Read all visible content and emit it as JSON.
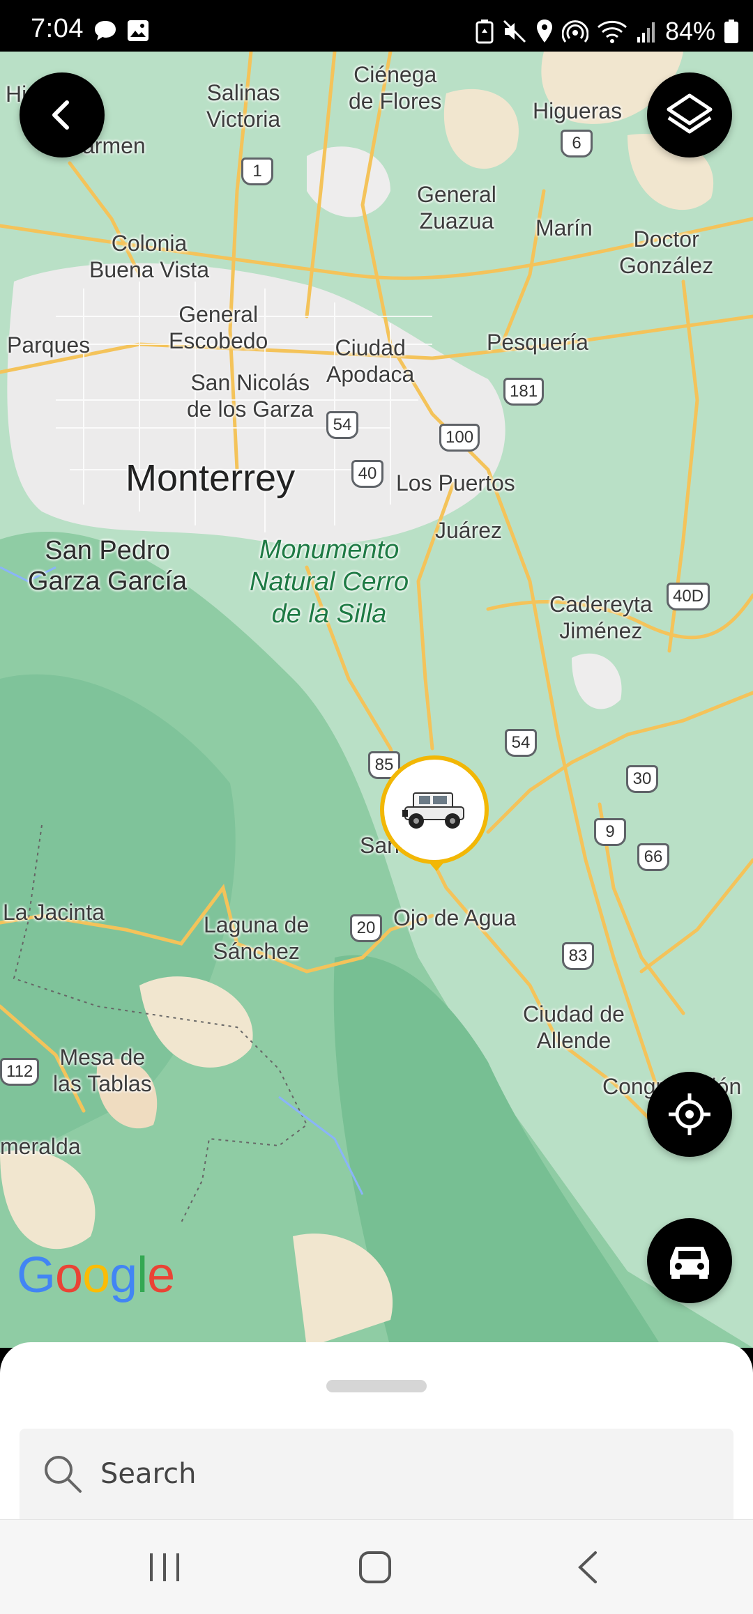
{
  "status_bar": {
    "time": "7:04",
    "battery_percent": "84%",
    "icons_left": [
      "chat-bubble-icon",
      "image-icon"
    ],
    "icons_right": [
      "battery-saver-icon",
      "mute-icon",
      "location-icon",
      "hotspot-icon",
      "wifi-icon",
      "signal-icon",
      "battery-icon"
    ]
  },
  "map": {
    "labels": [
      {
        "text": "Hi",
        "cls": ""
      },
      {
        "text": "Salinas\nVictoria",
        "cls": ""
      },
      {
        "text": "Ciénega\nde Flores",
        "cls": ""
      },
      {
        "text": "Higueras",
        "cls": ""
      },
      {
        "text": "armen",
        "cls": ""
      },
      {
        "text": "General\nZuazua",
        "cls": ""
      },
      {
        "text": "Marín",
        "cls": ""
      },
      {
        "text": "Doctor\nGonzález",
        "cls": ""
      },
      {
        "text": "Colonia\nBuena Vista",
        "cls": ""
      },
      {
        "text": "General\nEscobedo",
        "cls": ""
      },
      {
        "text": "Ciudad\nApodaca",
        "cls": ""
      },
      {
        "text": "Pesquería",
        "cls": ""
      },
      {
        "text": "Parques",
        "cls": ""
      },
      {
        "text": "San Nicolás\nde los Garza",
        "cls": ""
      },
      {
        "text": "Monterrey",
        "cls": "big"
      },
      {
        "text": "Los Puertos",
        "cls": ""
      },
      {
        "text": "Juárez",
        "cls": ""
      },
      {
        "text": "San Pedro\nGarza García",
        "cls": "medium"
      },
      {
        "text": "Monumento\nNatural Cerro\nde la Silla",
        "cls": "park"
      },
      {
        "text": "Cadereyta\nJiménez",
        "cls": ""
      },
      {
        "text": "San",
        "cls": ""
      },
      {
        "text": "La Jacinta",
        "cls": ""
      },
      {
        "text": "Laguna de\nSánchez",
        "cls": ""
      },
      {
        "text": "Ojo de Agua",
        "cls": ""
      },
      {
        "text": "Ciudad de\nAllende",
        "cls": ""
      },
      {
        "text": "Mesa de\nlas Tablas",
        "cls": ""
      },
      {
        "text": "Congregación",
        "cls": ""
      },
      {
        "text": "meralda",
        "cls": ""
      }
    ],
    "shields": [
      "6",
      "1",
      "181",
      "54",
      "100",
      "40",
      "40D",
      "54",
      "85",
      "30",
      "9",
      "66",
      "20",
      "83",
      "112"
    ],
    "attribution": "Google"
  },
  "buttons": {
    "back": "back-arrow-icon",
    "layers": "layers-icon",
    "locate": "crosshair-icon",
    "vehicles": "car-icon"
  },
  "search": {
    "placeholder": "Search"
  },
  "colors": {
    "marker_ring": "#f2b705",
    "fab_background": "#000000",
    "map_green": "#b6dfc3",
    "road": "#f6c85f"
  }
}
